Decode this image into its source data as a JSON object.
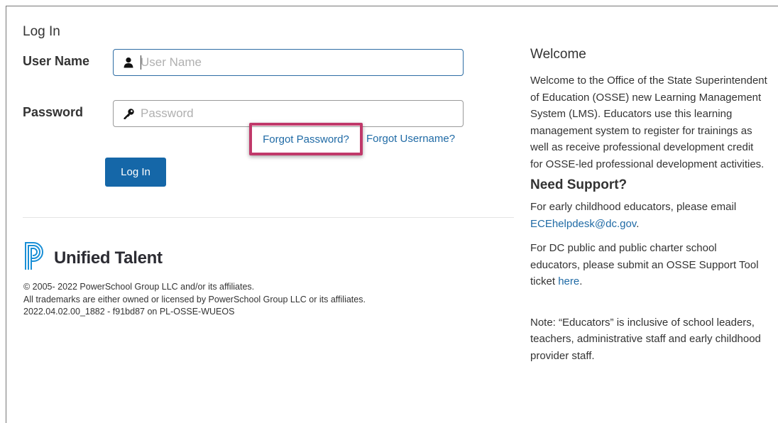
{
  "login": {
    "title": "Log In",
    "username_label": "User Name",
    "username_placeholder": "User Name",
    "password_label": "Password",
    "password_placeholder": "Password",
    "forgot_password": "Forgot Password?",
    "forgot_username": "Forgot Username?",
    "login_button": "Log In"
  },
  "brand": {
    "name": "Unified Talent",
    "logo_icon": "powerschool-p-logo"
  },
  "legal": {
    "line1": "© 2005- 2022 PowerSchool Group LLC and/or its affiliates.",
    "line2": "All trademarks are either owned or licensed by PowerSchool Group LLC or its affiliates.",
    "version": "2022.04.02.00_1882 - f91bd87 on PL-OSSE-WUEOS"
  },
  "welcome": {
    "heading": "Welcome",
    "body": "Welcome to the Office of the State Superintendent of Education (OSSE) new Learning Management System (LMS). Educators use this learning management system to register for trainings as well as receive professional development credit for OSSE-led professional development activities."
  },
  "support": {
    "heading": "Need Support?",
    "early_text": "For early childhood educators, please email",
    "early_email": "ECEhelpdesk@dc.gov",
    "early_suffix": ".",
    "dc_text": "For DC public and public charter school educators, please submit an OSSE Support Tool ticket",
    "dc_link": "here",
    "dc_suffix": "."
  },
  "note": {
    "text": "Note: “Educators” is inclusive of school leaders, teachers, administrative staff and early childhood provider staff."
  },
  "colors": {
    "accent": "#1567a8",
    "link": "#1f6aa5",
    "highlight": "#c0396a"
  }
}
